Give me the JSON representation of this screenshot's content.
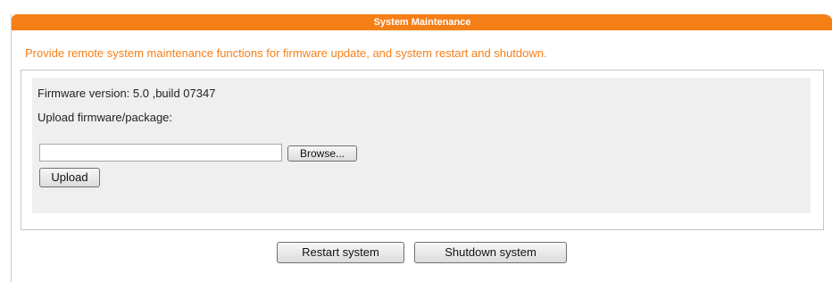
{
  "header": {
    "title": "System Maintenance"
  },
  "description": "Provide remote system maintenance functions for firmware update, and system restart and shutdown.",
  "firmware": {
    "version_text": "Firmware version: 5.0 ,build 07347",
    "upload_label": "Upload firmware/package:",
    "file_value": "",
    "browse_label": "Browse...",
    "upload_button": "Upload"
  },
  "actions": {
    "restart_label": "Restart system",
    "shutdown_label": "Shutdown system"
  },
  "colors": {
    "accent": "#f57f17",
    "panel_bg": "#efefef"
  }
}
